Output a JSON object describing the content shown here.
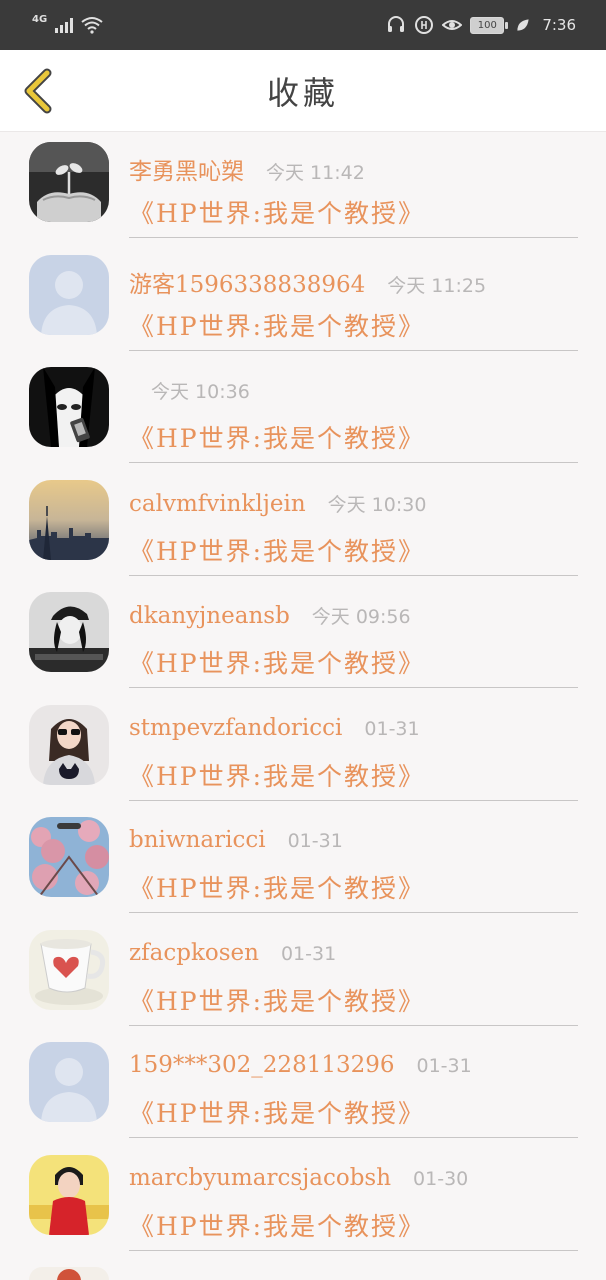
{
  "status_bar": {
    "network": "4G",
    "battery": "100",
    "time": "7:36"
  },
  "header": {
    "title": "收藏",
    "back_icon": "chevron-left-icon"
  },
  "colors": {
    "accent": "#e8935c",
    "back_arrow": "#e9c73a",
    "time_text": "#b9b7b7"
  },
  "favorites": [
    {
      "username": "李勇黑吣槊",
      "time": "今天 11:42",
      "title": "《HP世界:我是个教授》",
      "avatar": "hands-plant"
    },
    {
      "username": "游客1596338838964",
      "time": "今天 11:25",
      "title": "《HP世界:我是个教授》",
      "avatar": "default-person"
    },
    {
      "username": "",
      "time": "今天 10:36",
      "title": "《HP世界:我是个教授》",
      "avatar": "anime-girl"
    },
    {
      "username": "calvmfvinkljein",
      "time": "今天 10:30",
      "title": "《HP世界:我是个教授》",
      "avatar": "city-skyline"
    },
    {
      "username": "dkanyjneansb",
      "time": "今天 09:56",
      "title": "《HP世界:我是个教授》",
      "avatar": "girl-cap"
    },
    {
      "username": "stmpevzfandoricci",
      "time": "01-31",
      "title": "《HP世界:我是个教授》",
      "avatar": "girl-sunglasses"
    },
    {
      "username": "bniwnaricci",
      "time": "01-31",
      "title": "《HP世界:我是个教授》",
      "avatar": "blossom-sky"
    },
    {
      "username": "zfacpkosen",
      "time": "01-31",
      "title": "《HP世界:我是个教授》",
      "avatar": "heart-cup"
    },
    {
      "username": "159***302_228113296",
      "time": "01-31",
      "title": "《HP世界:我是个教授》",
      "avatar": "default-person"
    },
    {
      "username": "marcbyumarcsjacobsh",
      "time": "01-30",
      "title": "《HP世界:我是个教授》",
      "avatar": "girl-red"
    }
  ]
}
